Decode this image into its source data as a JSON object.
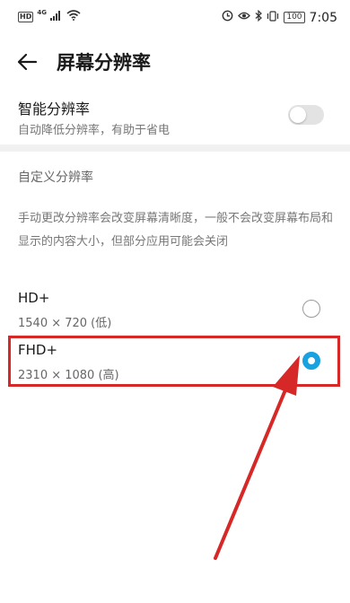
{
  "status_bar": {
    "left_badge": "HD",
    "network": "4G",
    "battery": "100",
    "time": "7:05"
  },
  "header": {
    "title": "屏幕分辨率"
  },
  "smart_resolution": {
    "title": "智能分辨率",
    "subtitle": "自动降低分辨率，有助于省电",
    "enabled": false
  },
  "custom_section": {
    "title": "自定义分辨率",
    "description": "手动更改分辨率会改变屏幕清晰度，一般不会改变屏幕布局和显示的内容大小，但部分应用可能会关闭"
  },
  "options": [
    {
      "label": "HD+",
      "desc": "1540 × 720 (低)",
      "selected": false
    },
    {
      "label": "FHD+",
      "desc": "2310 × 1080 (高)",
      "selected": true
    }
  ],
  "colors": {
    "accent": "#1aa1e0",
    "annotation": "#d72828"
  }
}
